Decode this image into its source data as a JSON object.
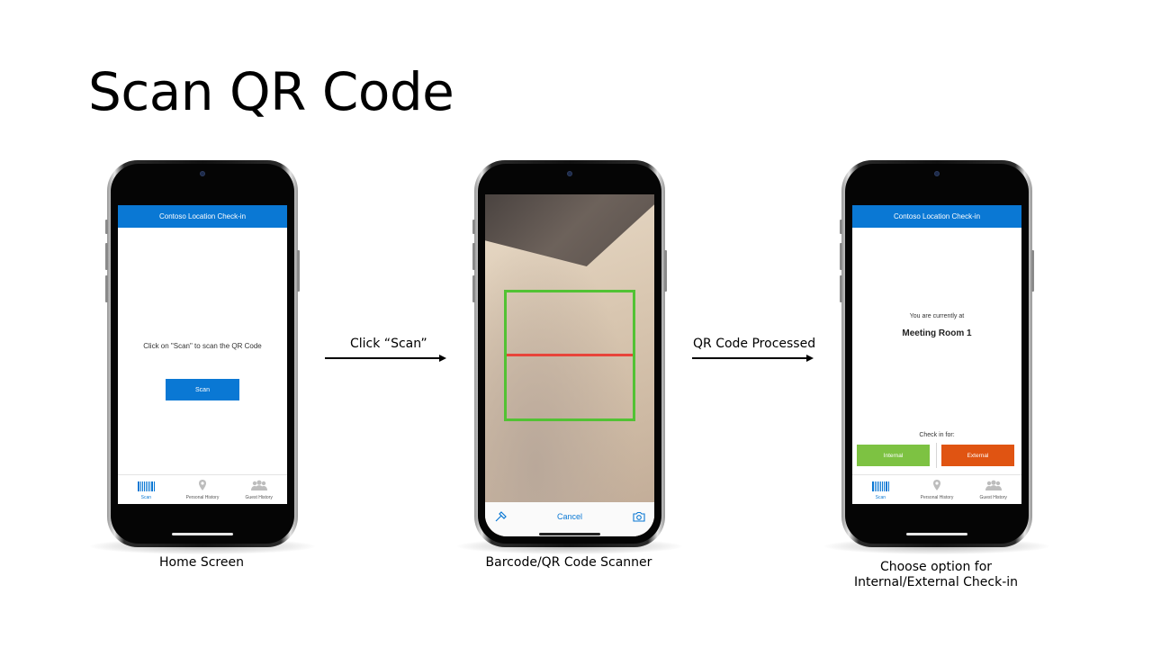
{
  "slide": {
    "title": "Scan QR Code"
  },
  "app": {
    "header_title": "Contoso Location Check-in",
    "accent": "#0a78d4"
  },
  "tabs": [
    {
      "label": "Scan",
      "icon": "barcode-icon",
      "active": true
    },
    {
      "label": "Personal History",
      "icon": "location-pin-icon",
      "active": false
    },
    {
      "label": "Guest History",
      "icon": "people-icon",
      "active": false
    }
  ],
  "home_screen": {
    "instruction": "Click on \"Scan\" to scan the QR Code",
    "scan_button": "Scan",
    "caption": "Home Screen"
  },
  "scanner_screen": {
    "cancel": "Cancel",
    "caption": "Barcode/QR Code Scanner",
    "frame_color": "#52c234",
    "line_color": "#e8443a"
  },
  "checkin_screen": {
    "currently_at": "You are currently at",
    "room": "Meeting Room 1",
    "check_in_for": "Check in for:",
    "internal": "Internal",
    "external": "External",
    "internal_color": "#7dc242",
    "external_color": "#e05412",
    "caption_line1": "Choose option for",
    "caption_line2": "Internal/External Check-in"
  },
  "arrows": {
    "first": "Click “Scan”",
    "second": "QR Code Processed"
  }
}
